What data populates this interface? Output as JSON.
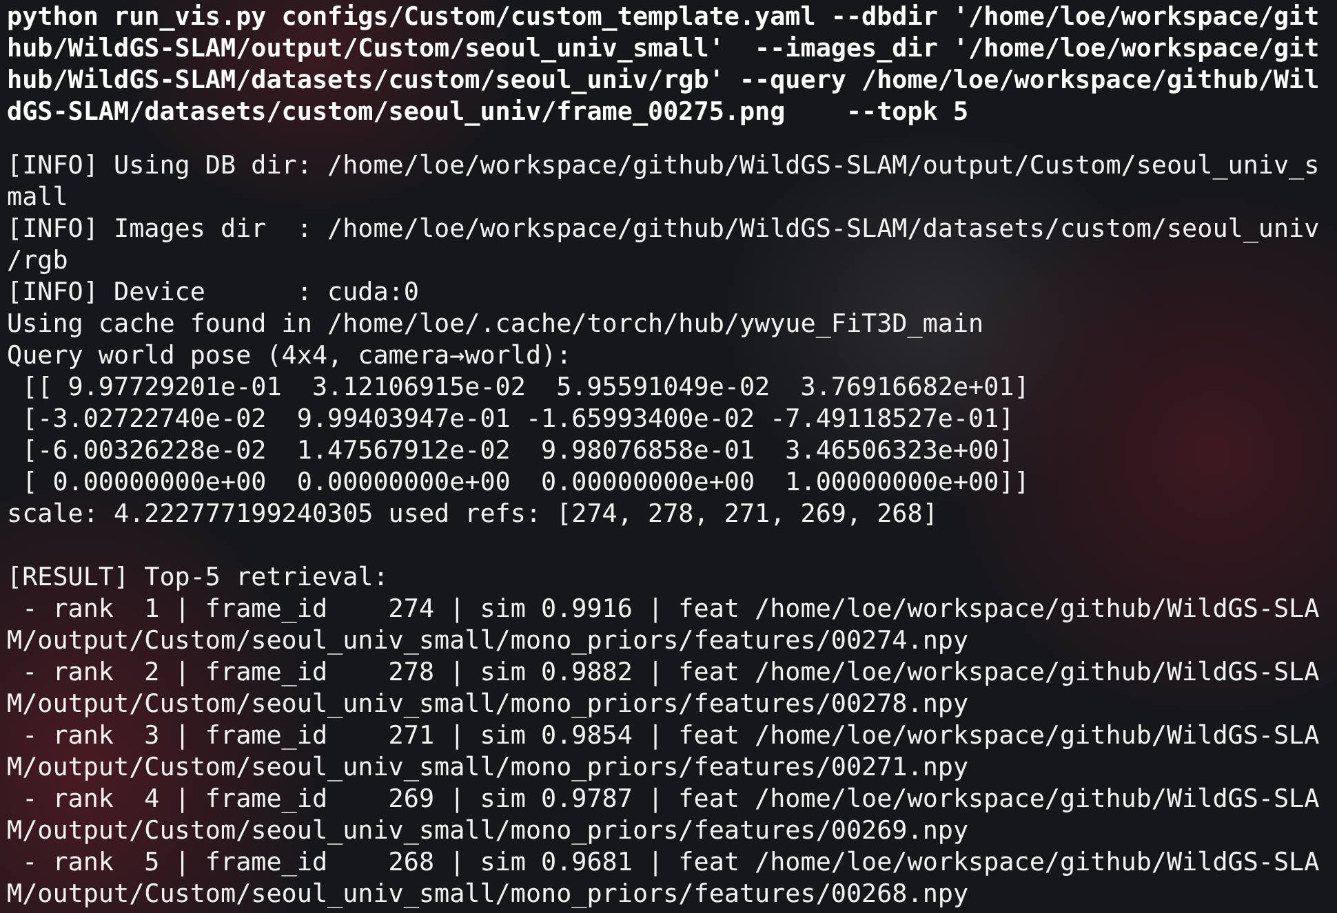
{
  "terminal": {
    "command_lines": [
      "python run_vis.py configs/Custom/custom_template.yaml --dbdir '/home/loe/workspace/git",
      "hub/WildGS-SLAM/output/Custom/seoul_univ_small'  --images_dir '/home/loe/workspace/git",
      "hub/WildGS-SLAM/datasets/custom/seoul_univ/rgb' --query /home/loe/workspace/github/Wil",
      "dGS-SLAM/datasets/custom/seoul_univ/frame_00275.png    --topk 5"
    ],
    "output_lines": [
      {
        "kind": "text",
        "text": "[INFO] Using DB dir: /home/loe/workspace/github/WildGS-SLAM/output/Custom/seoul_univ_s"
      },
      {
        "kind": "text",
        "text": "mall"
      },
      {
        "kind": "text",
        "text": "[INFO] Images dir  : /home/loe/workspace/github/WildGS-SLAM/datasets/custom/seoul_univ"
      },
      {
        "kind": "text",
        "text": "/rgb"
      },
      {
        "kind": "text",
        "text": "[INFO] Device      : cuda:0"
      },
      {
        "kind": "text",
        "text": "Using cache found in /home/loe/.cache/torch/hub/ywyue_FiT3D_main"
      },
      {
        "kind": "text",
        "text": "Query world pose (4x4, camera→world):"
      },
      {
        "kind": "text",
        "text": " [[ 9.97729201e-01  3.12106915e-02  5.95591049e-02  3.76916682e+01]"
      },
      {
        "kind": "text",
        "text": " [-3.02722740e-02  9.99403947e-01 -1.65993400e-02 -7.49118527e-01]"
      },
      {
        "kind": "text",
        "text": " [-6.00326228e-02  1.47567912e-02  9.98076858e-01  3.46506323e+00]"
      },
      {
        "kind": "text",
        "text": " [ 0.00000000e+00  0.00000000e+00  0.00000000e+00  1.00000000e+00]]"
      },
      {
        "kind": "text",
        "text": "scale: 4.222777199240305 used refs: [274, 278, 271, 269, 268]"
      },
      {
        "kind": "blank"
      },
      {
        "kind": "text",
        "text": "[RESULT] Top-5 retrieval:"
      },
      {
        "kind": "text",
        "text": " - rank  1 | frame_id    274 | sim 0.9916 | feat /home/loe/workspace/github/WildGS-SLA"
      },
      {
        "kind": "text",
        "text": "M/output/Custom/seoul_univ_small/mono_priors/features/00274.npy"
      },
      {
        "kind": "text",
        "text": " - rank  2 | frame_id    278 | sim 0.9882 | feat /home/loe/workspace/github/WildGS-SLA"
      },
      {
        "kind": "text",
        "text": "M/output/Custom/seoul_univ_small/mono_priors/features/00278.npy"
      },
      {
        "kind": "text",
        "text": " - rank  3 | frame_id    271 | sim 0.9854 | feat /home/loe/workspace/github/WildGS-SLA"
      },
      {
        "kind": "text",
        "text": "M/output/Custom/seoul_univ_small/mono_priors/features/00271.npy"
      },
      {
        "kind": "text",
        "text": " - rank  4 | frame_id    269 | sim 0.9787 | feat /home/loe/workspace/github/WildGS-SLA"
      },
      {
        "kind": "text",
        "text": "M/output/Custom/seoul_univ_small/mono_priors/features/00269.npy"
      },
      {
        "kind": "text",
        "text": " - rank  5 | frame_id    268 | sim 0.9681 | feat /home/loe/workspace/github/WildGS-SLA"
      },
      {
        "kind": "text",
        "text": "M/output/Custom/seoul_univ_small/mono_priors/features/00268.npy"
      }
    ]
  }
}
